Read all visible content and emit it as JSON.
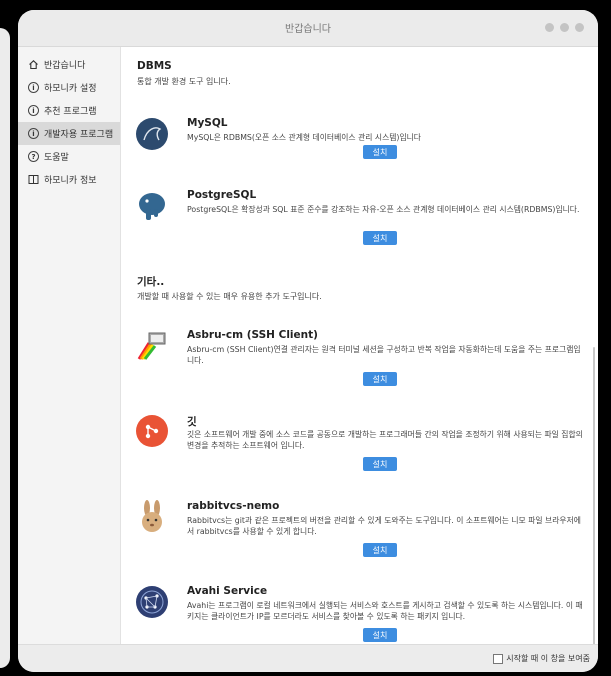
{
  "window": {
    "title": "반갑습니다"
  },
  "sidebar": {
    "items": [
      {
        "label": "반갑습니다",
        "icon": "home-icon"
      },
      {
        "label": "하모니카 설정",
        "icon": "info-icon"
      },
      {
        "label": "추천 프로그램",
        "icon": "info-icon"
      },
      {
        "label": "개발자용 프로그램",
        "icon": "info-icon"
      },
      {
        "label": "도움말",
        "icon": "help-icon"
      },
      {
        "label": "하모니카 정보",
        "icon": "book-icon"
      }
    ],
    "active_index": 3
  },
  "dbms": {
    "title": "DBMS",
    "desc": "통합 개발 환경 도구 입니다.",
    "apps": [
      {
        "name": "MySQL",
        "desc": "MySQL은 RDBMS(오픈 소스 관계형 데이터베이스 관리 시스템)입니다",
        "button": "설치",
        "icon": "mysql-icon"
      },
      {
        "name": "PostgreSQL",
        "desc": "PostgreSQL은 확장성과 SQL 표준 준수를 강조하는 자유-오픈 소스 관계형 데이터베이스 관리 시스템(RDBMS)입니다.",
        "button": "설치",
        "icon": "postgresql-icon"
      }
    ]
  },
  "etc": {
    "title": "기타..",
    "desc": "개발할 때 사용할 수 있는 매우 유용한 추가 도구입니다.",
    "apps": [
      {
        "name": "Asbru-cm (SSH Client)",
        "desc": "Asbru-cm (SSH Client)연결 관리자는 원격 터미널 세션을 구성하고 반복 작업을 자동화하는데 도움을 주는 프로그램입니다.",
        "button": "설치",
        "icon": "asbru-icon"
      },
      {
        "name": "깃",
        "desc": "깃은 소프트웨어 개발 중에 소스 코드를 공동으로 개발하는 프로그래머들 간의 작업을 조정하기 위해 사용되는 파일 집합의 변경을 추적하는 소프트웨어 입니다.",
        "button": "설치",
        "icon": "git-icon"
      },
      {
        "name": "rabbitvcs-nemo",
        "desc": "Rabbitvcs는 git과 같은 프로젝트의 버전을 관리할 수 있게 도와주는 도구입니다. 이 소프트웨어는 니모 파일 브라우저에서 rabbitvcs를 사용할 수 있게 합니다.",
        "button": "설치",
        "icon": "rabbit-icon"
      },
      {
        "name": "Avahi Service",
        "desc": "Avahi는 프로그램이 로컬 네트워크에서 실행되는 서비스와 호스트를 게시하고 검색할 수 있도록 하는 시스템입니다. 이 패키지는 클라이언트가 IP를 모르더라도 서비스를 찾아볼 수 있도록 하는 패키지 입니다.",
        "button": "설치",
        "icon": "avahi-icon"
      }
    ]
  },
  "footer": {
    "startup_label": "시작할 때 이 창을 보여줌",
    "startup_checked": false
  },
  "colors": {
    "accent": "#3d8de0"
  }
}
